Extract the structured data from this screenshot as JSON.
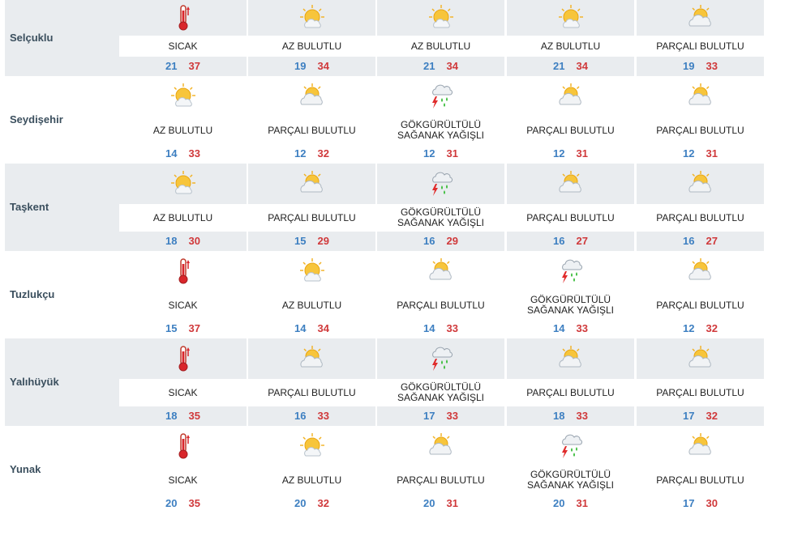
{
  "rows": [
    {
      "city": "Selçuklu",
      "days": [
        {
          "icon": "thermometer-icon",
          "cond": "SICAK",
          "min": "21",
          "max": "37"
        },
        {
          "icon": "sun-cloud-icon",
          "cond": "AZ BULUTLU",
          "min": "19",
          "max": "34"
        },
        {
          "icon": "sun-cloud-icon",
          "cond": "AZ BULUTLU",
          "min": "21",
          "max": "34"
        },
        {
          "icon": "sun-cloud-icon",
          "cond": "AZ BULUTLU",
          "min": "21",
          "max": "34"
        },
        {
          "icon": "cloud-sun-icon",
          "cond": "PARÇALI BULUTLU",
          "min": "19",
          "max": "33"
        }
      ]
    },
    {
      "city": "Seydişehir",
      "days": [
        {
          "icon": "sun-cloud-icon",
          "cond": "AZ BULUTLU",
          "min": "14",
          "max": "33"
        },
        {
          "icon": "cloud-sun-icon",
          "cond": "PARÇALI BULUTLU",
          "min": "12",
          "max": "32"
        },
        {
          "icon": "thunderstorm-icon",
          "cond": "GÖKGÜRÜLTÜLÜ SAĞANAK YAĞIŞLI",
          "min": "12",
          "max": "31"
        },
        {
          "icon": "cloud-sun-icon",
          "cond": "PARÇALI BULUTLU",
          "min": "12",
          "max": "31"
        },
        {
          "icon": "cloud-sun-icon",
          "cond": "PARÇALI BULUTLU",
          "min": "12",
          "max": "31"
        }
      ]
    },
    {
      "city": "Taşkent",
      "days": [
        {
          "icon": "sun-cloud-icon",
          "cond": "AZ BULUTLU",
          "min": "18",
          "max": "30"
        },
        {
          "icon": "cloud-sun-icon",
          "cond": "PARÇALI BULUTLU",
          "min": "15",
          "max": "29"
        },
        {
          "icon": "thunderstorm-icon",
          "cond": "GÖKGÜRÜLTÜLÜ SAĞANAK YAĞIŞLI",
          "min": "16",
          "max": "29"
        },
        {
          "icon": "cloud-sun-icon",
          "cond": "PARÇALI BULUTLU",
          "min": "16",
          "max": "27"
        },
        {
          "icon": "cloud-sun-icon",
          "cond": "PARÇALI BULUTLU",
          "min": "16",
          "max": "27"
        }
      ]
    },
    {
      "city": "Tuzlukçu",
      "days": [
        {
          "icon": "thermometer-icon",
          "cond": "SICAK",
          "min": "15",
          "max": "37"
        },
        {
          "icon": "sun-cloud-icon",
          "cond": "AZ BULUTLU",
          "min": "14",
          "max": "34"
        },
        {
          "icon": "cloud-sun-icon",
          "cond": "PARÇALI BULUTLU",
          "min": "14",
          "max": "33"
        },
        {
          "icon": "thunderstorm-icon",
          "cond": "GÖKGÜRÜLTÜLÜ SAĞANAK YAĞIŞLI",
          "min": "14",
          "max": "33"
        },
        {
          "icon": "cloud-sun-icon",
          "cond": "PARÇALI BULUTLU",
          "min": "12",
          "max": "32"
        }
      ]
    },
    {
      "city": "Yalıhüyük",
      "days": [
        {
          "icon": "thermometer-icon",
          "cond": "SICAK",
          "min": "18",
          "max": "35"
        },
        {
          "icon": "cloud-sun-icon",
          "cond": "PARÇALI BULUTLU",
          "min": "16",
          "max": "33"
        },
        {
          "icon": "thunderstorm-icon",
          "cond": "GÖKGÜRÜLTÜLÜ SAĞANAK YAĞIŞLI",
          "min": "17",
          "max": "33"
        },
        {
          "icon": "cloud-sun-icon",
          "cond": "PARÇALI BULUTLU",
          "min": "18",
          "max": "33"
        },
        {
          "icon": "cloud-sun-icon",
          "cond": "PARÇALI BULUTLU",
          "min": "17",
          "max": "32"
        }
      ]
    },
    {
      "city": "Yunak",
      "days": [
        {
          "icon": "thermometer-icon",
          "cond": "SICAK",
          "min": "20",
          "max": "35"
        },
        {
          "icon": "sun-cloud-icon",
          "cond": "AZ BULUTLU",
          "min": "20",
          "max": "32"
        },
        {
          "icon": "cloud-sun-icon",
          "cond": "PARÇALI BULUTLU",
          "min": "20",
          "max": "31"
        },
        {
          "icon": "thunderstorm-icon",
          "cond": "GÖKGÜRÜLTÜLÜ SAĞANAK YAĞIŞLI",
          "min": "20",
          "max": "31"
        },
        {
          "icon": "cloud-sun-icon",
          "cond": "PARÇALI BULUTLU",
          "min": "17",
          "max": "30"
        }
      ]
    }
  ]
}
